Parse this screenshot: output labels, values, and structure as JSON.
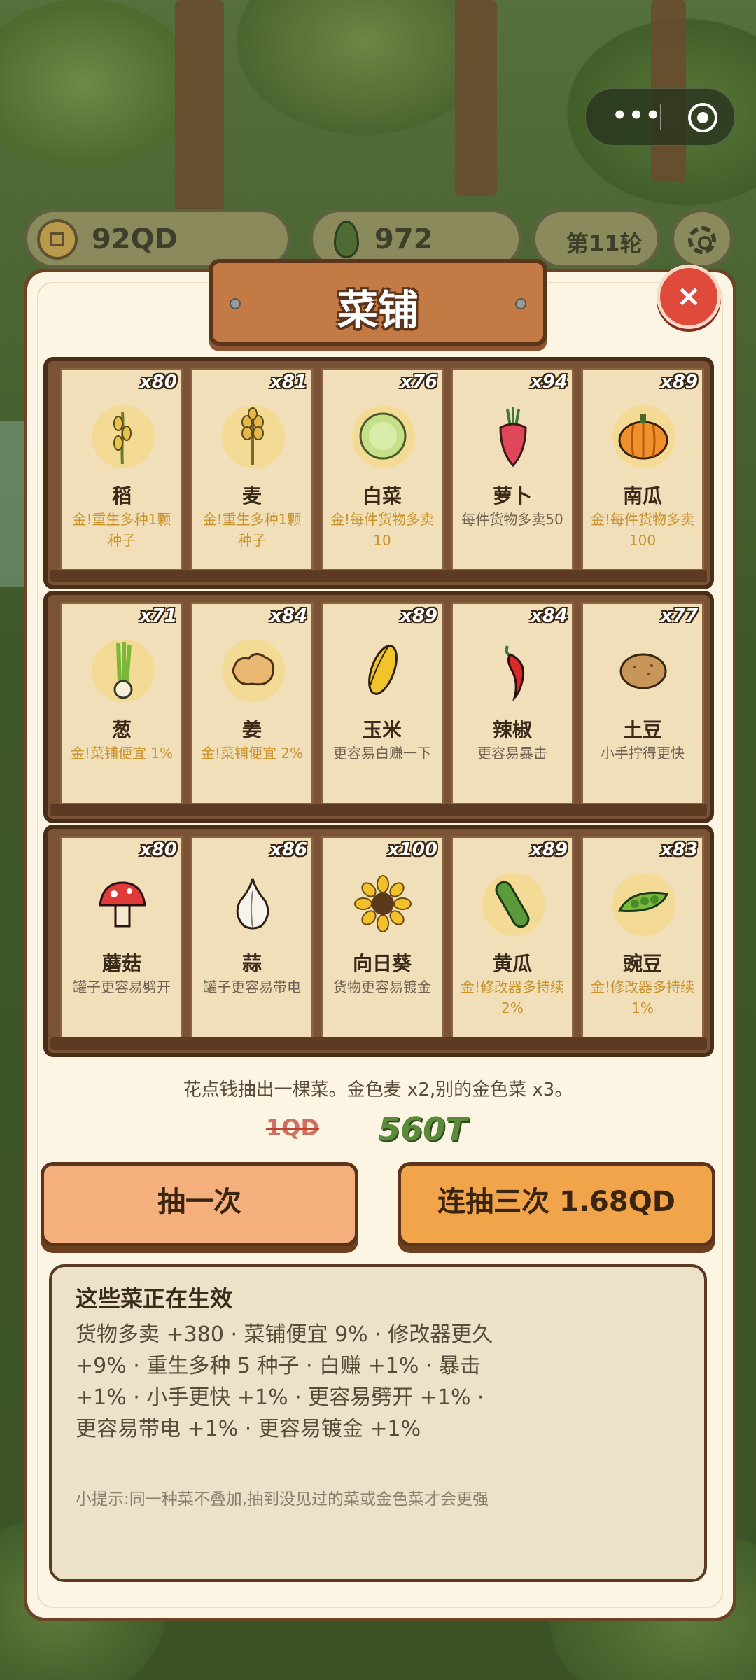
{
  "top_bar": {
    "coins": "92QD",
    "seeds": "972",
    "round": "第11轮"
  },
  "shop": {
    "title": "菜铺",
    "close_label": "×",
    "rows": [
      [
        {
          "count": "x80",
          "name": "稻",
          "desc": "金!重生多种1颗种子",
          "gold": true,
          "icon": "rice-icon"
        },
        {
          "count": "x81",
          "name": "麦",
          "desc": "金!重生多种1颗种子",
          "gold": true,
          "icon": "wheat-icon"
        },
        {
          "count": "x76",
          "name": "白菜",
          "desc": "金!每件货物多卖10",
          "gold": true,
          "icon": "cabbage-icon"
        },
        {
          "count": "x94",
          "name": "萝卜",
          "desc": "每件货物多卖50",
          "gold": false,
          "icon": "radish-icon"
        },
        {
          "count": "x89",
          "name": "南瓜",
          "desc": "金!每件货物多卖100",
          "gold": true,
          "icon": "pumpkin-icon"
        }
      ],
      [
        {
          "count": "x71",
          "name": "葱",
          "desc": "金!菜铺便宜 1%",
          "gold": true,
          "icon": "scallion-icon"
        },
        {
          "count": "x84",
          "name": "姜",
          "desc": "金!菜铺便宜 2%",
          "gold": true,
          "icon": "ginger-icon"
        },
        {
          "count": "x89",
          "name": "玉米",
          "desc": "更容易白赚一下",
          "gold": false,
          "icon": "corn-icon"
        },
        {
          "count": "x84",
          "name": "辣椒",
          "desc": "更容易暴击",
          "gold": false,
          "icon": "chili-icon"
        },
        {
          "count": "x77",
          "name": "土豆",
          "desc": "小手拧得更快",
          "gold": false,
          "icon": "potato-icon"
        }
      ],
      [
        {
          "count": "x80",
          "name": "蘑菇",
          "desc": "罐子更容易劈开",
          "gold": false,
          "icon": "mushroom-icon"
        },
        {
          "count": "x86",
          "name": "蒜",
          "desc": "罐子更容易带电",
          "gold": false,
          "icon": "garlic-icon"
        },
        {
          "count": "x100",
          "name": "向日葵",
          "desc": "货物更容易镀金",
          "gold": false,
          "icon": "sunflower-icon"
        },
        {
          "count": "x89",
          "name": "黄瓜",
          "desc": "金!修改器多持续2%",
          "gold": true,
          "icon": "cucumber-icon"
        },
        {
          "count": "x83",
          "name": "豌豆",
          "desc": "金!修改器多持续1%",
          "gold": true,
          "icon": "pea-icon"
        }
      ]
    ],
    "info": "花点钱抽出一棵菜。金色麦 x2,别的金色菜 x3。",
    "old_price": "1QD",
    "new_price": "560T",
    "draw_once": "抽一次",
    "draw_three": "连抽三次 1.68QD",
    "effects_title": "这些菜正在生效",
    "effects_text": "货物多卖 +380 · 菜铺便宜 9% · 修改器更久 +9% · 重生多种 5 种子 · 白赚 +1% · 暴击 +1% · 小手更快 +1% · 更容易劈开 +1% · 更容易带电 +1% · 更容易镀金 +1%",
    "tip": "小提示:同一种菜不叠加,抽到没见过的菜或金色菜才会更强"
  },
  "colors": {
    "gold_text": "#c9922a",
    "plain_text": "#6f6252",
    "close_red": "#e04a3a",
    "button_orange": "#f2a44a",
    "price_green": "#5a8a3a"
  }
}
